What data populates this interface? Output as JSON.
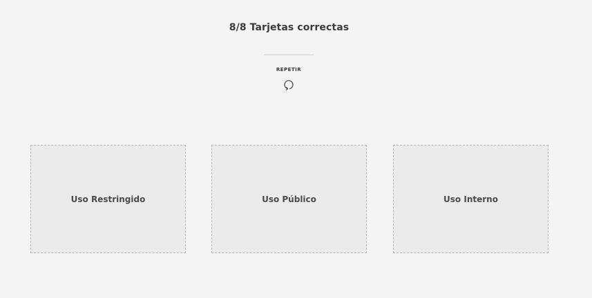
{
  "result": {
    "title": "8/8 Tarjetas correctas"
  },
  "repeat": {
    "label": "REPETIR",
    "icon": "refresh-icon"
  },
  "dropzones": [
    {
      "label": "Uso Restringido"
    },
    {
      "label": "Uso Público"
    },
    {
      "label": "Uso Interno"
    }
  ]
}
